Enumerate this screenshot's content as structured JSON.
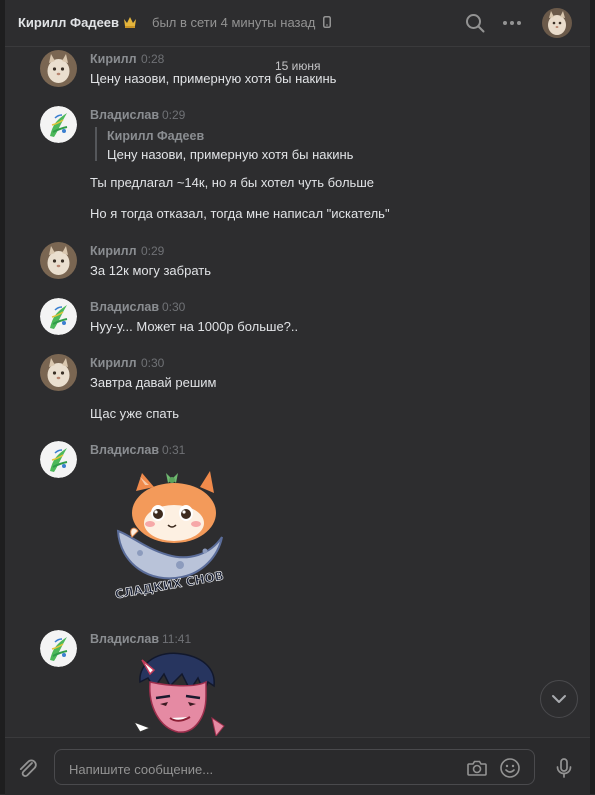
{
  "header": {
    "peer_name": "Кирилл Фадеев",
    "status": "был в сети 4 минуты назад",
    "icons": [
      "crown-icon",
      "phone-icon",
      "search-icon",
      "more-icon"
    ]
  },
  "date_separator": "15 июня",
  "messages": [
    {
      "author": "Кирилл",
      "time": "0:28",
      "lines": [
        "Цену назови, примерную хотя бы накинь"
      ]
    },
    {
      "author": "Владислав",
      "time": "0:29",
      "quote": {
        "author": "Кирилл Фадеев",
        "text": "Цену назови, примерную хотя бы накинь"
      },
      "lines": [
        "Ты предлагал ~14к, но я бы хотел чуть больше",
        "Но я тогда отказал, тогда мне написал \"искатель\""
      ]
    },
    {
      "author": "Кирилл",
      "time": "0:29",
      "lines": [
        "За 12к могу забрать"
      ]
    },
    {
      "author": "Владислав",
      "time": "0:30",
      "lines": [
        "Нуу-у... Может на 1000р больше?.."
      ]
    },
    {
      "author": "Кирилл",
      "time": "0:30",
      "lines": [
        "Завтра давай решим",
        "Щас уже спать"
      ]
    },
    {
      "author": "Владислав",
      "time": "0:31",
      "sticker": "sleeping-cat-moon-sticker",
      "sticker_text": "СЛАДКИХ СНОВ"
    },
    {
      "author": "Владислав",
      "time": "11:41",
      "sticker": "demon-guy-sticker"
    }
  ],
  "composer": {
    "placeholder": "Напишите сообщение..."
  },
  "colors": {
    "background": "#2d2d2f",
    "text": "#e1e3e6",
    "muted": "#939393",
    "author": "#8a8d91"
  }
}
